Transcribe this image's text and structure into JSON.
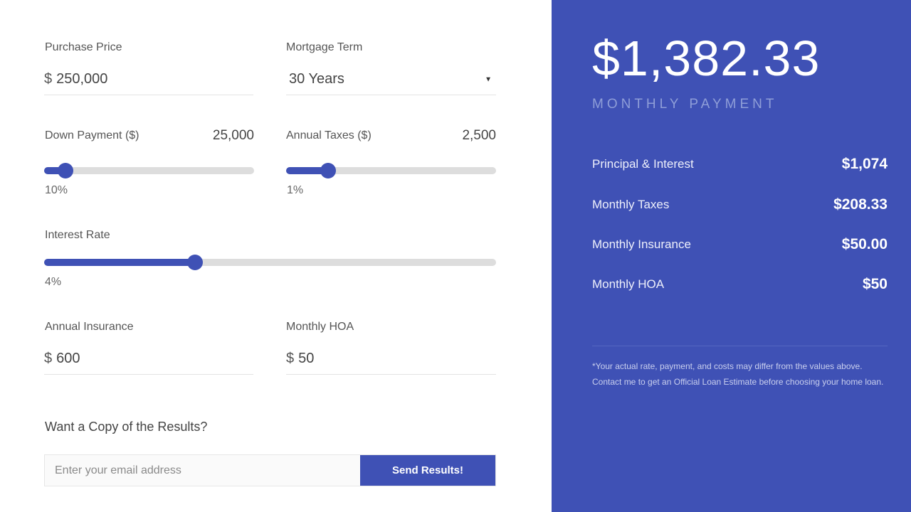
{
  "form": {
    "purchase_price": {
      "label": "Purchase Price",
      "currency": "$",
      "value": "250,000"
    },
    "mortgage_term": {
      "label": "Mortgage Term",
      "value": "30 Years",
      "arrow": "▼"
    },
    "down_payment": {
      "label": "Down Payment ($)",
      "value": "25,000",
      "percent_label": "10%",
      "percent": 10
    },
    "annual_taxes": {
      "label": "Annual Taxes ($)",
      "value": "2,500",
      "percent_label": "1%",
      "percent": 1
    },
    "interest_rate": {
      "label": "Interest Rate",
      "percent_label": "4%",
      "percent": 4
    },
    "annual_insurance": {
      "label": "Annual Insurance",
      "currency": "$",
      "value": "600"
    },
    "monthly_hoa": {
      "label": "Monthly HOA",
      "currency": "$",
      "value": "50"
    }
  },
  "copy": {
    "heading": "Want a Copy of the Results?",
    "email_placeholder": "Enter your email address",
    "send_label": "Send Results!"
  },
  "results": {
    "monthly_payment": "$1,382.33",
    "monthly_payment_label": "MONTHLY PAYMENT",
    "breakdown": [
      {
        "label": "Principal & Interest",
        "value": "$1,074"
      },
      {
        "label": "Monthly Taxes",
        "value": "$208.33"
      },
      {
        "label": "Monthly Insurance",
        "value": "$50.00"
      },
      {
        "label": "Monthly HOA",
        "value": "$50"
      }
    ],
    "disclaimer": "*Your actual rate, payment, and costs may differ from the values above. Contact me to get an Official Loan Estimate before choosing your home loan."
  },
  "colors": {
    "accent": "#3f51b5",
    "track": "#dddddd"
  }
}
